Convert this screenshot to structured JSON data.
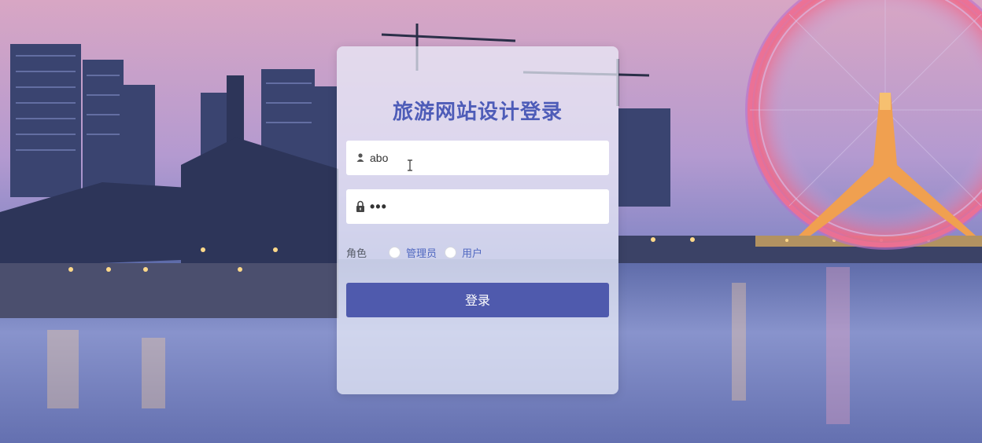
{
  "login": {
    "title": "旅游网站设计登录",
    "username": {
      "value": "abo",
      "placeholder": ""
    },
    "password": {
      "value": "•••",
      "placeholder": ""
    },
    "role": {
      "label": "角色",
      "options": [
        "管理员",
        "用户"
      ]
    },
    "submit_label": "登录"
  },
  "icons": {
    "username": "user-icon",
    "password": "lock-icon",
    "cursor": "text-cursor-icon"
  },
  "colors": {
    "title": "#4e5cb8",
    "button": "#4f5aad",
    "radio_text": "#5068c0",
    "card": "#ebeefa"
  }
}
